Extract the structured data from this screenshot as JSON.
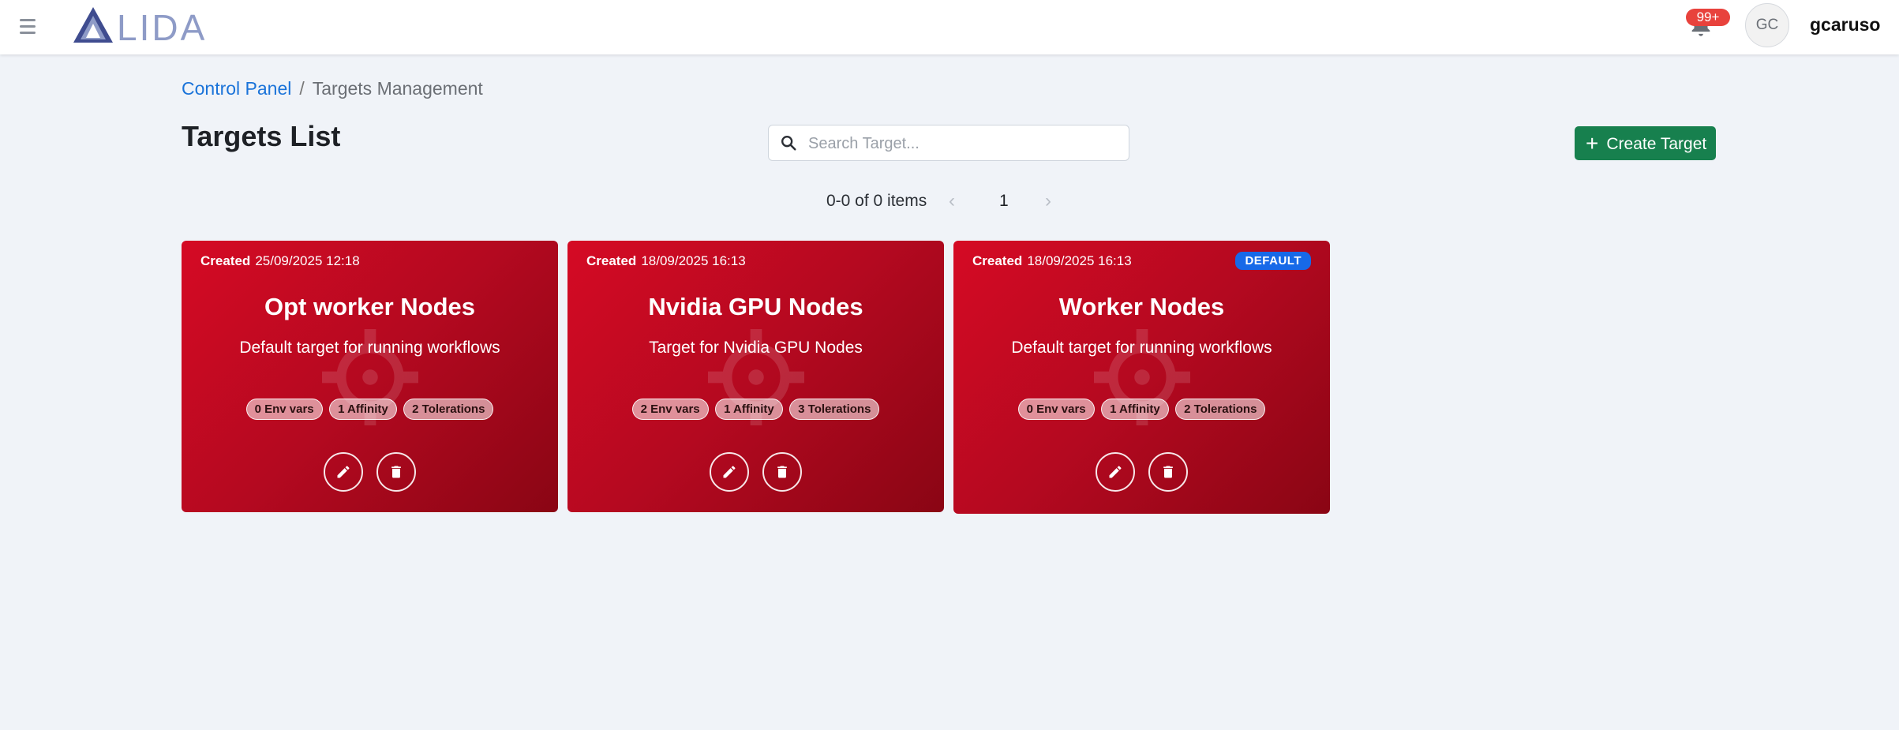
{
  "header": {
    "logo_text": "LIDA",
    "notifications_badge": "99+",
    "avatar_initials": "GC",
    "username": "gcaruso"
  },
  "breadcrumb": {
    "root": "Control Panel",
    "separator": "/",
    "current": "Targets Management"
  },
  "page": {
    "title": "Targets List",
    "search_placeholder": "Search Target...",
    "create_button_label": "Create Target"
  },
  "pagination": {
    "info": "0-0 of 0 items",
    "prev": "‹",
    "current_page": "1",
    "next": "›"
  },
  "cards": [
    {
      "created_label": "Created",
      "created_date": "25/09/2025 12:18",
      "title": "Opt worker Nodes",
      "description": "Default target for running workflows",
      "chips": [
        "0 Env vars",
        "1 Affinity",
        "2 Tolerations"
      ]
    },
    {
      "created_label": "Created",
      "created_date": "18/09/2025 16:13",
      "title": "Nvidia GPU Nodes",
      "description": "Target for Nvidia GPU Nodes",
      "chips": [
        "2 Env vars",
        "1 Affinity",
        "3 Tolerations"
      ]
    },
    {
      "created_label": "Created",
      "created_date": "18/09/2025 16:13",
      "default_badge": "DEFAULT",
      "title": "Worker Nodes",
      "description": "Default target for running workflows",
      "chips": [
        "0 Env vars",
        "1 Affinity",
        "2 Tolerations"
      ]
    }
  ],
  "colors": {
    "card_red": "#c40a22",
    "create_green": "#17804e",
    "link_blue": "#1a73d9",
    "default_badge_blue": "#1769e8",
    "notification_red": "#e8423c"
  },
  "icons": {
    "menu": "hamburger-menu-icon",
    "logo": "lida-logo-icon",
    "bell": "bell-icon",
    "search": "search-icon",
    "plus": "plus-icon",
    "edit": "pencil-icon",
    "delete": "trash-icon",
    "watermark": "crosshair-target-icon"
  }
}
